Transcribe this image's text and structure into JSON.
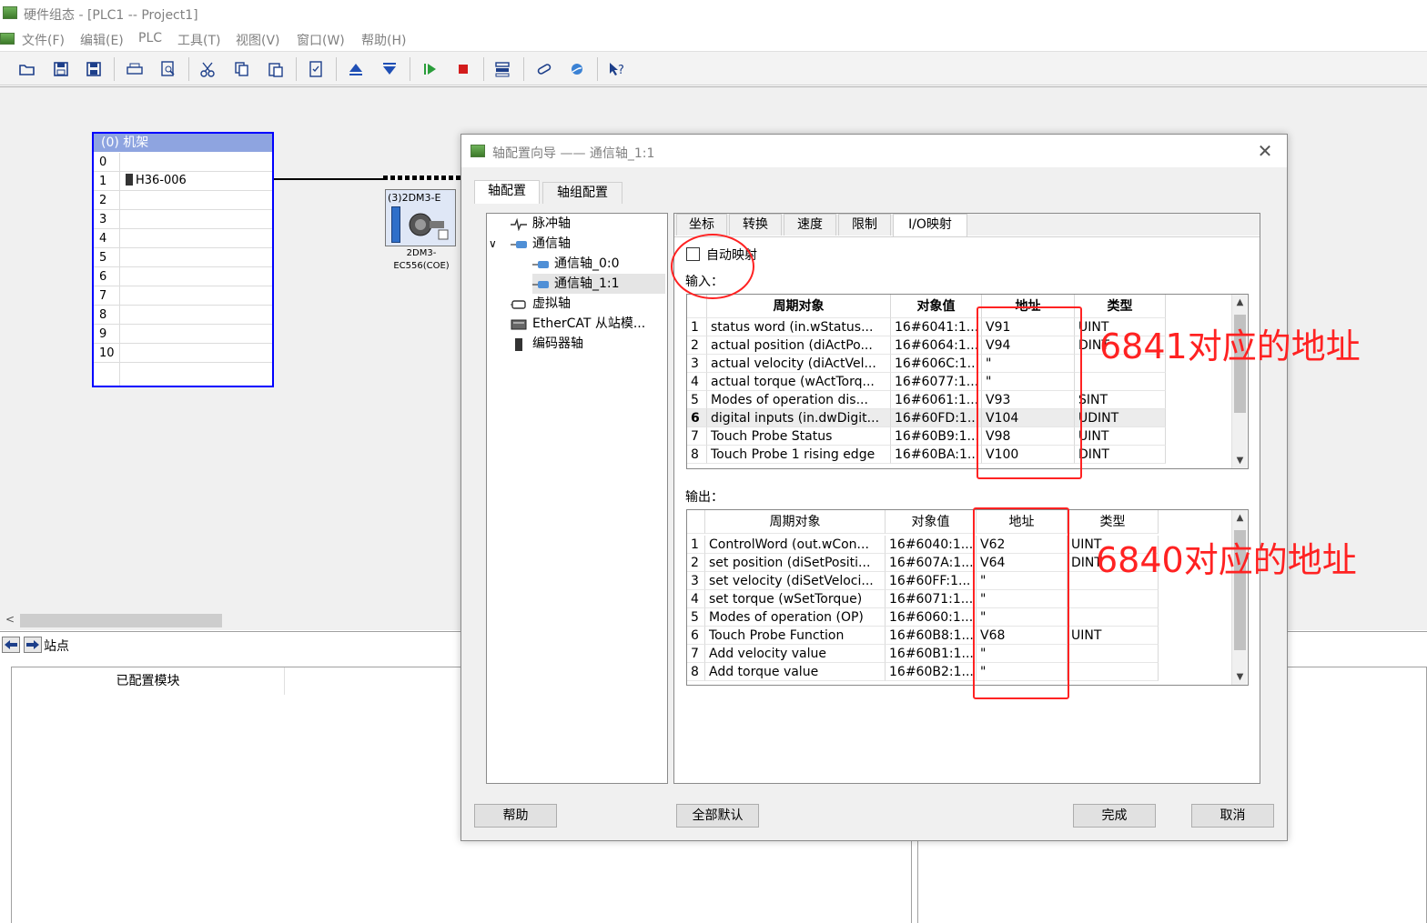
{
  "window": {
    "title": "硬件组态 - [PLC1 -- Project1]"
  },
  "menu": [
    "文件(F)",
    "编辑(E)",
    "PLC",
    "工具(T)",
    "视图(V)",
    "窗口(W)",
    "帮助(H)"
  ],
  "rack": {
    "header": "(0) 机架",
    "rows": [
      {
        "num": "0",
        "module": ""
      },
      {
        "num": "1",
        "module": "H36-006"
      },
      {
        "num": "2",
        "module": ""
      },
      {
        "num": "3",
        "module": ""
      },
      {
        "num": "4",
        "module": ""
      },
      {
        "num": "5",
        "module": ""
      },
      {
        "num": "6",
        "module": ""
      },
      {
        "num": "7",
        "module": ""
      },
      {
        "num": "8",
        "module": ""
      },
      {
        "num": "9",
        "module": ""
      },
      {
        "num": "10",
        "module": ""
      }
    ]
  },
  "device": {
    "label": "(3)2DM3-E",
    "caption_line1": "2DM3-",
    "caption_line2": "EC556(COE)"
  },
  "station_label": "站点",
  "configured_modules_header": "已配置模块",
  "dialog": {
    "title": "轴配置向导 —— 通信轴_1:1",
    "close": "✕",
    "tabs": [
      "轴配置",
      "轴组配置"
    ],
    "tree": [
      {
        "label": "脉冲轴",
        "icon": "pulse-icon"
      },
      {
        "label": "通信轴",
        "icon": "comm-axis-icon",
        "expander": "∨"
      },
      {
        "label": "通信轴_0:0",
        "icon": "comm-axis-icon"
      },
      {
        "label": "通信轴_1:1",
        "icon": "comm-axis-icon"
      },
      {
        "label": "虚拟轴",
        "icon": "virtual-axis-icon"
      },
      {
        "label": "EtherCAT 从站模...",
        "icon": "ethercat-icon"
      },
      {
        "label": "编码器轴",
        "icon": "encoder-icon"
      }
    ],
    "subtabs": [
      "坐标",
      "转换",
      "速度",
      "限制",
      "I/O映射"
    ],
    "auto_map_label": "自动映射",
    "input_label": "输入：",
    "output_label": "输出：",
    "columns": [
      "周期对象",
      "对象值",
      "地址",
      "类型"
    ],
    "input_rows": [
      {
        "n": "1",
        "obj": "status word (in.wStatus...",
        "val": "16#6041:1...",
        "addr": "V91",
        "type": "UINT"
      },
      {
        "n": "2",
        "obj": "actual position (diActPo...",
        "val": "16#6064:1...",
        "addr": "V94",
        "type": "DINT"
      },
      {
        "n": "3",
        "obj": "actual velocity (diActVel...",
        "val": "16#606C:1...",
        "addr": "\"",
        "type": ""
      },
      {
        "n": "4",
        "obj": "actual torque (wActTorq...",
        "val": "16#6077:1...",
        "addr": "\"",
        "type": ""
      },
      {
        "n": "5",
        "obj": "Modes of operation dis...",
        "val": "16#6061:1...",
        "addr": "V93",
        "type": "SINT"
      },
      {
        "n": "6",
        "obj": "digital inputs (in.dwDigit...",
        "val": "16#60FD:1...",
        "addr": "V104",
        "type": "UDINT"
      },
      {
        "n": "7",
        "obj": "Touch Probe Status",
        "val": "16#60B9:1...",
        "addr": "V98",
        "type": "UINT"
      },
      {
        "n": "8",
        "obj": "Touch Probe 1 rising edge",
        "val": "16#60BA:1...",
        "addr": "V100",
        "type": "DINT"
      }
    ],
    "output_rows": [
      {
        "n": "1",
        "obj": "ControlWord (out.wCon...",
        "val": "16#6040:1...",
        "addr": "V62",
        "type": "UINT"
      },
      {
        "n": "2",
        "obj": "set position (diSetPositi...",
        "val": "16#607A:1...",
        "addr": "V64",
        "type": "DINT"
      },
      {
        "n": "3",
        "obj": "set velocity (diSetVeloci...",
        "val": "16#60FF:1...",
        "addr": "\"",
        "type": ""
      },
      {
        "n": "4",
        "obj": "set torque (wSetTorque)",
        "val": "16#6071:1...",
        "addr": "\"",
        "type": ""
      },
      {
        "n": "5",
        "obj": "Modes of operation (OP)",
        "val": "16#6060:1...",
        "addr": "\"",
        "type": ""
      },
      {
        "n": "6",
        "obj": "Touch Probe Function",
        "val": "16#60B8:1...",
        "addr": "V68",
        "type": "UINT"
      },
      {
        "n": "7",
        "obj": "Add velocity value",
        "val": "16#60B1:1...",
        "addr": "\"",
        "type": ""
      },
      {
        "n": "8",
        "obj": "Add torque value",
        "val": "16#60B2:1...",
        "addr": "\"",
        "type": ""
      }
    ],
    "buttons": {
      "help": "帮助",
      "reset_all": "全部默认",
      "finish": "完成",
      "cancel": "取消"
    }
  },
  "annotations": {
    "input_note": "6841对应的地址",
    "output_note": "6840对应的地址",
    "color": "#ff2222"
  }
}
